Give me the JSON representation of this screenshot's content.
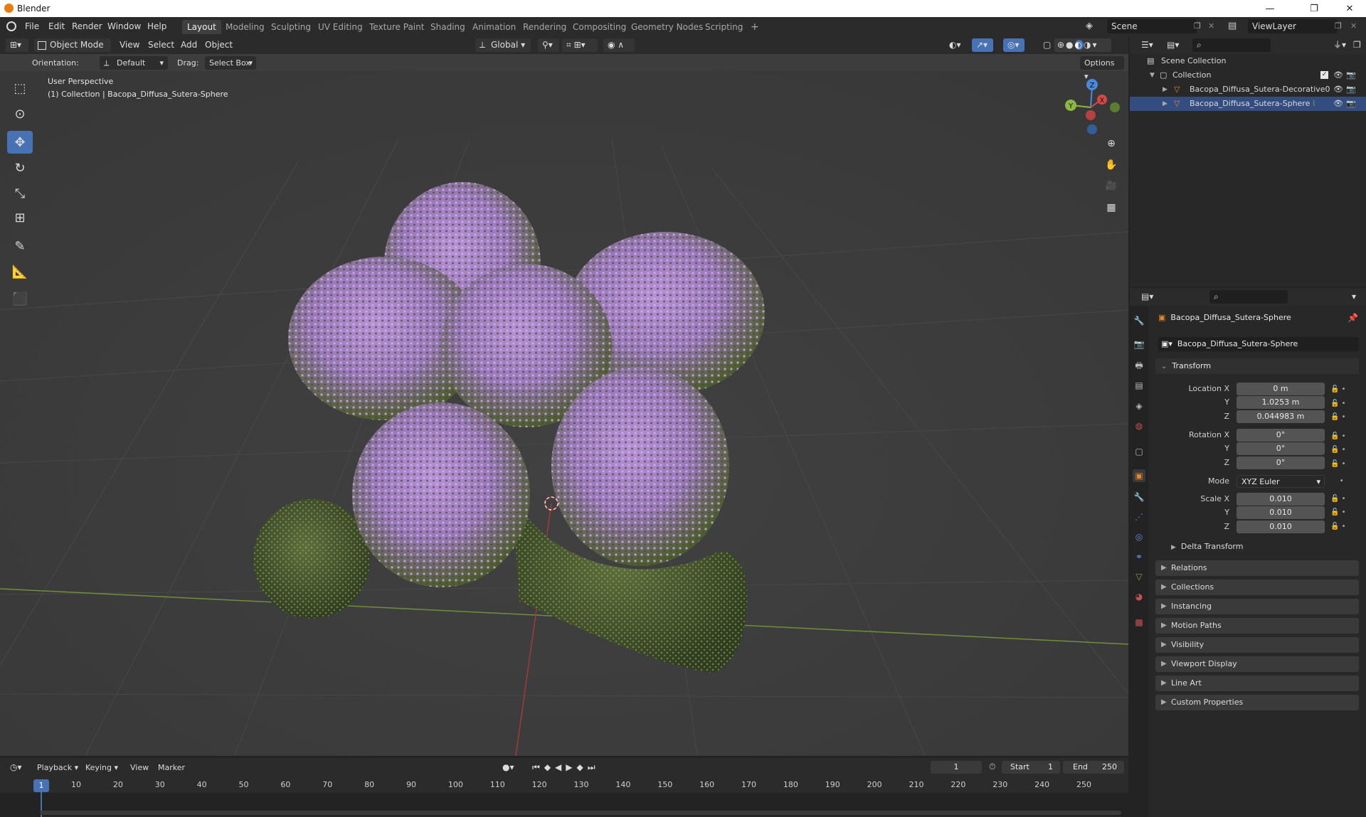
{
  "window": {
    "title": "Blender",
    "controls": [
      "—",
      "❐",
      "✕"
    ]
  },
  "menu": {
    "items": [
      "File",
      "Edit",
      "Render",
      "Window",
      "Help"
    ]
  },
  "workspaces": [
    "Layout",
    "Modeling",
    "Sculpting",
    "UV Editing",
    "Texture Paint",
    "Shading",
    "Animation",
    "Rendering",
    "Compositing",
    "Geometry Nodes",
    "Scripting",
    "+"
  ],
  "active_workspace": "Layout",
  "scene": {
    "name": "Scene",
    "viewlayer": "ViewLayer"
  },
  "header": {
    "mode": "Object Mode",
    "menus": [
      "View",
      "Select",
      "Add",
      "Object"
    ],
    "transform_space": "Global",
    "orientation_label": "Orientation:",
    "orientation_value": "Default",
    "drag_label": "Drag:",
    "drag_value": "Select Box",
    "options": "Options"
  },
  "viewport": {
    "perspective": "User Perspective",
    "collection_info": "(1) Collection | Bacopa_Diffusa_Sutera-Sphere",
    "gizmo": {
      "x": "X",
      "y": "Y",
      "z": "Z"
    }
  },
  "outliner": {
    "root": "Scene Collection",
    "collection": "Collection",
    "objects": [
      "Bacopa_Diffusa_Sutera-Decorative0",
      "Bacopa_Diffusa_Sutera-Sphere"
    ]
  },
  "properties": {
    "object_name": "Bacopa_Diffusa_Sutera-Sphere",
    "datablock_name": "Bacopa_Diffusa_Sutera-Sphere",
    "transform_title": "Transform",
    "location": {
      "label": "Location X",
      "x": "0 m",
      "y": "1.0253 m",
      "z": "0.044983 m"
    },
    "rotation": {
      "label": "Rotation X",
      "x": "0°",
      "y": "0°",
      "z": "0°"
    },
    "mode_label": "Mode",
    "mode_value": "XYZ Euler",
    "scale": {
      "label": "Scale X",
      "x": "0.010",
      "y": "0.010",
      "z": "0.010"
    },
    "axis_y": "Y",
    "axis_z": "Z",
    "delta_transform": "Delta Transform",
    "panels": [
      "Relations",
      "Collections",
      "Instancing",
      "Motion Paths",
      "Visibility",
      "Viewport Display",
      "Line Art",
      "Custom Properties"
    ]
  },
  "timeline": {
    "menus": [
      "Playback",
      "Keying",
      "View",
      "Marker"
    ],
    "current_frame": "1",
    "start_label": "Start",
    "start": "1",
    "end_label": "End",
    "end": "250",
    "ticks": [
      "1",
      "10",
      "20",
      "30",
      "40",
      "50",
      "60",
      "70",
      "80",
      "90",
      "100",
      "110",
      "120",
      "130",
      "140",
      "150",
      "160",
      "170",
      "180",
      "190",
      "200",
      "210",
      "220",
      "230",
      "240",
      "250"
    ]
  },
  "colors": {
    "accent": "#4772b3",
    "flower": "#b98ad6",
    "foliage": "#3f5228",
    "grid_x": "#b03a3a",
    "grid_y": "#7fa24a"
  }
}
